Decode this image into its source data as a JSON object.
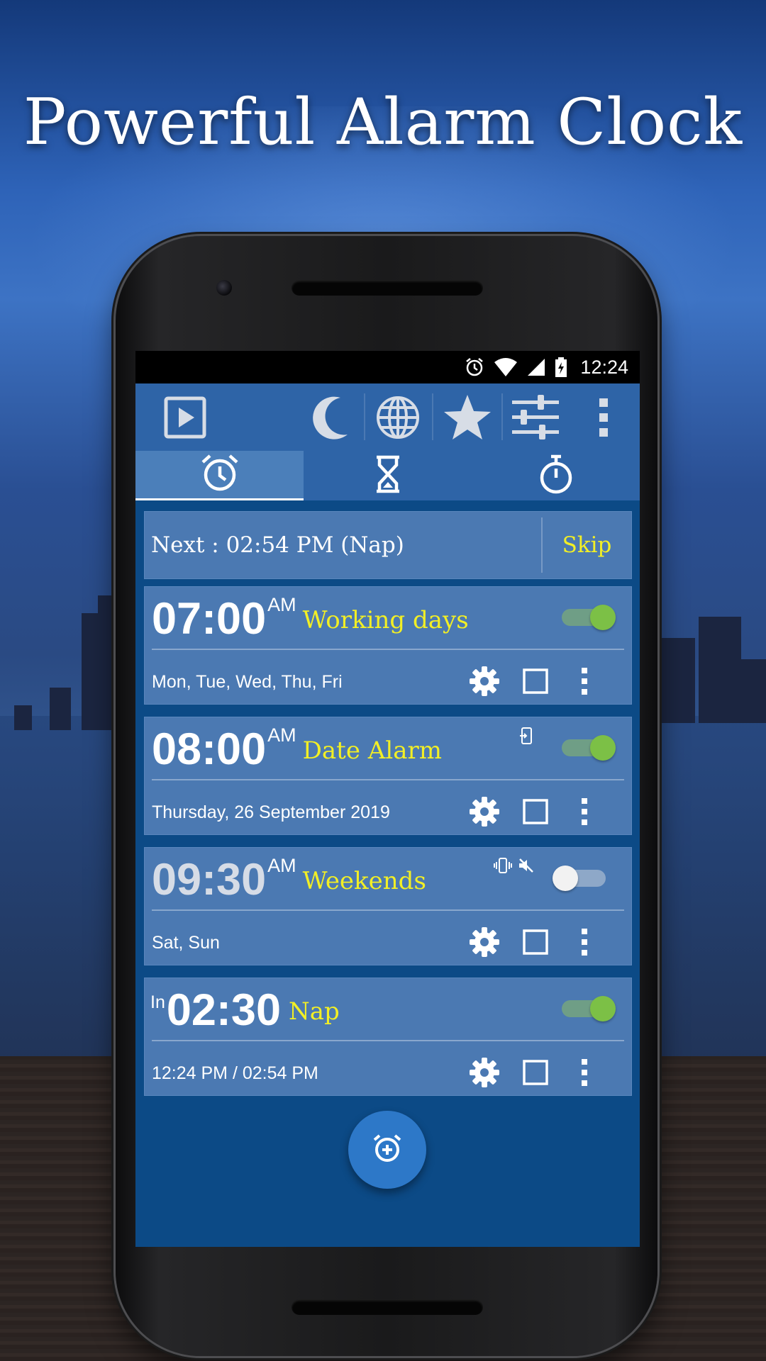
{
  "headline": "Powerful Alarm Clock",
  "status_bar": {
    "time": "12:24",
    "icons": [
      "alarm-icon",
      "wifi-icon",
      "signal-icon",
      "battery-charging-icon"
    ]
  },
  "toolbar": {
    "icons": [
      "play-icon",
      "moon-icon",
      "globe-icon",
      "star-icon",
      "sliders-icon",
      "more-vert-icon"
    ]
  },
  "tabs": [
    {
      "icon": "alarm-clock-icon",
      "active": true
    },
    {
      "icon": "hourglass-icon",
      "active": false
    },
    {
      "icon": "stopwatch-icon",
      "active": false
    }
  ],
  "next_alarm": {
    "text": "Next : 02:54 PM (Nap)",
    "skip_label": "Skip"
  },
  "alarms": [
    {
      "prefix": "",
      "time": "07:00",
      "ampm": "AM",
      "label": "Working days",
      "days": "Mon, Tue, Wed, Thu, Fri",
      "enabled": true
    },
    {
      "prefix": "",
      "time": "08:00",
      "ampm": "AM",
      "label": "Date Alarm",
      "days": "Thursday, 26 September 2019",
      "enabled": true
    },
    {
      "prefix": "",
      "time": "09:30",
      "ampm": "AM",
      "label": "Weekends",
      "days": "Sat, Sun",
      "enabled": false
    },
    {
      "prefix": "In",
      "time": "02:30",
      "ampm": "",
      "label": "Nap",
      "days": "12:24 PM / 02:54 PM",
      "enabled": true
    }
  ],
  "fab": {
    "icon": "add-alarm-icon"
  },
  "colors": {
    "accent_yellow": "#f2ef25",
    "toggle_on": "#7cc046",
    "toolbar_blue": "#2e64a7",
    "card_blue": "#4b79b2",
    "screen_blue": "#0c4a86"
  }
}
